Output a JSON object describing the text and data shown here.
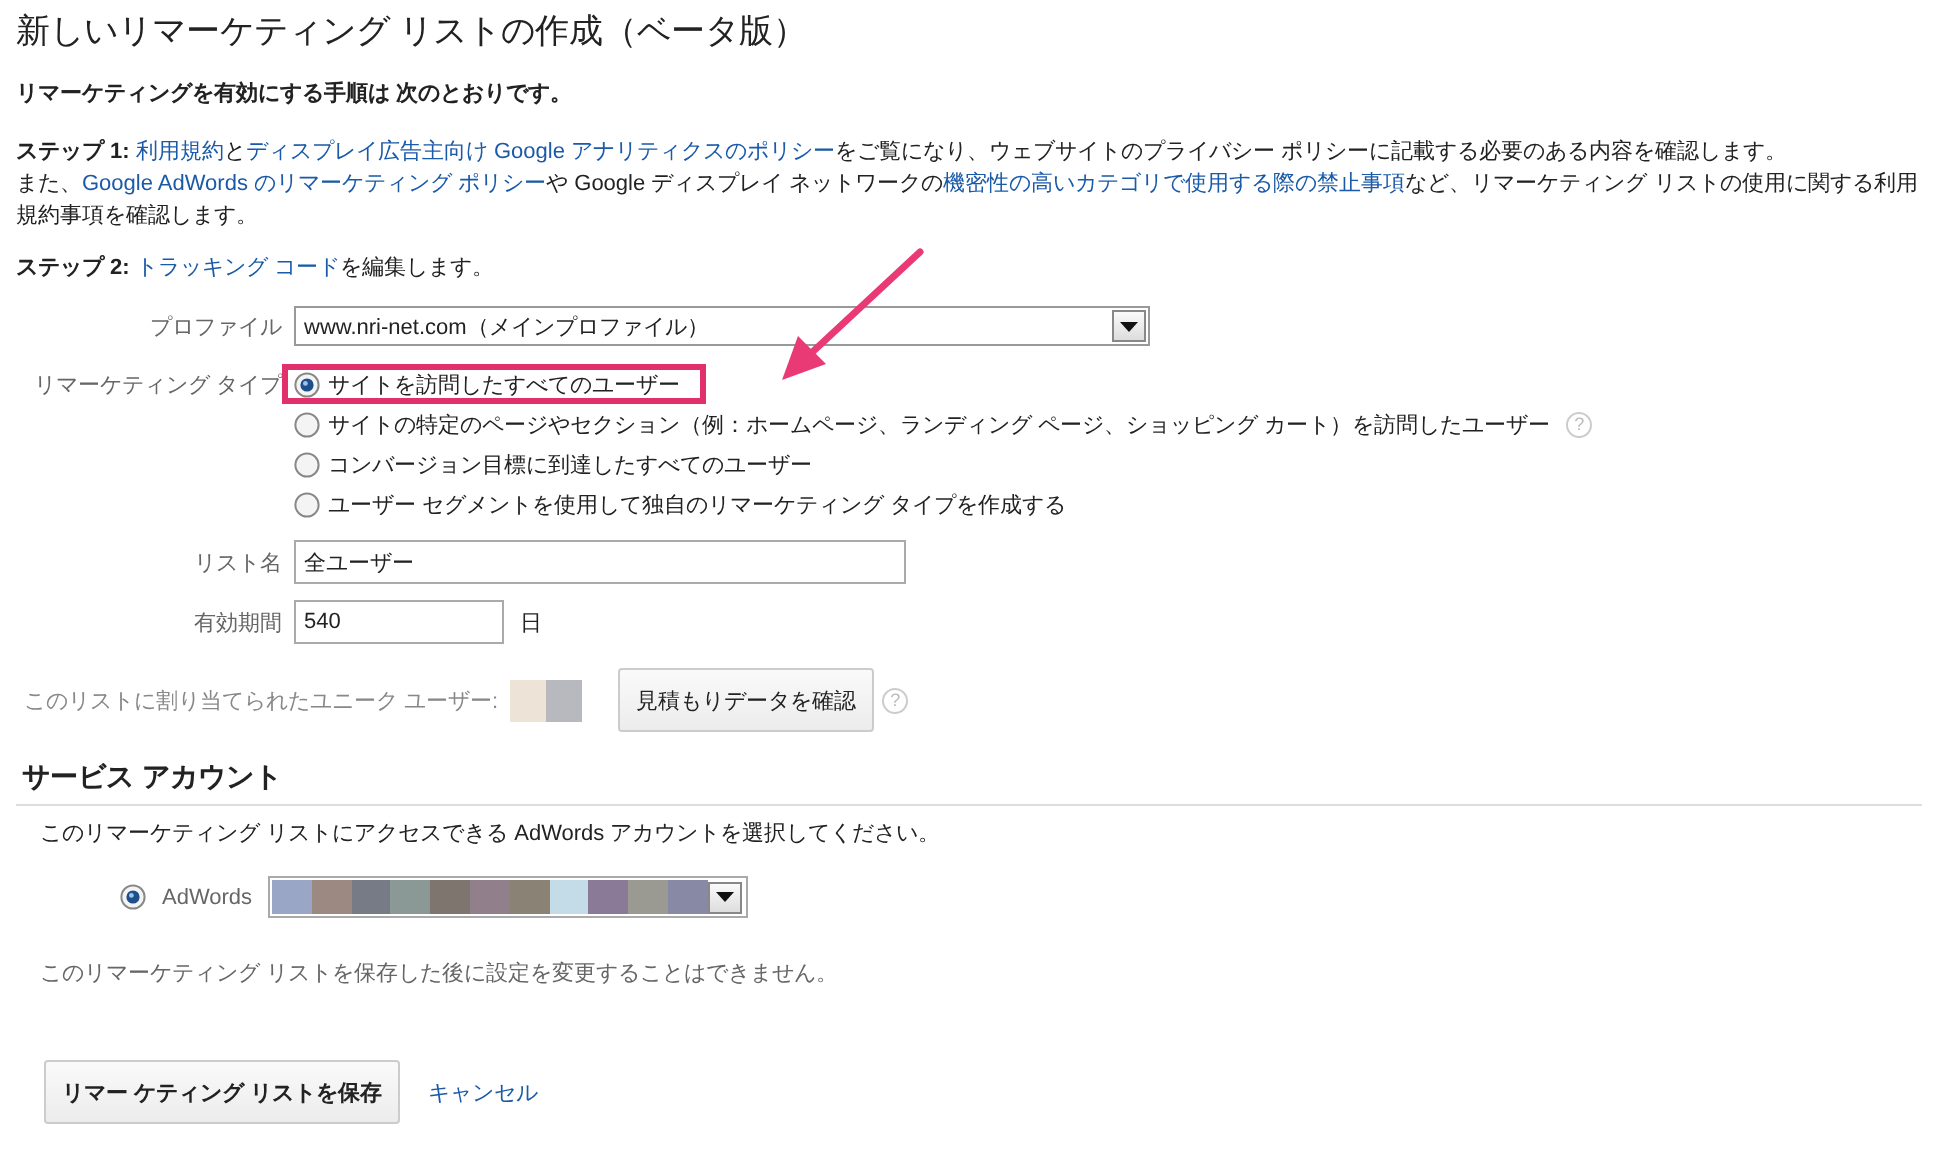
{
  "title": "新しいリマーケティング リストの作成（ベータ版）",
  "intro": "リマーケティングを有効にする手順は 次のとおりです。",
  "steps": [
    {
      "parts": [
        {
          "kind": "bold",
          "text": "ステップ 1:"
        },
        {
          "kind": "link",
          "text": "利用規約"
        },
        {
          "kind": "text",
          "text": "と"
        },
        {
          "kind": "link",
          "text": "ディスプレイ広告主向け Google アナリティクスのポリシー"
        },
        {
          "kind": "text",
          "text": "をご覧になり、ウェブサイトのプライバシー ポリシーに記載する必要のある内容を確認します。"
        },
        {
          "kind": "break",
          "text": "また、"
        },
        {
          "kind": "link",
          "text": "Google AdWords のリマーケティング ポリシー"
        },
        {
          "kind": "text",
          "text": "や Google ディスプレイ ネットワークの"
        },
        {
          "kind": "link",
          "text": "機密性の高いカテゴリで使用する際の禁止事項"
        },
        {
          "kind": "text",
          "text": "など、リマーケティング リストの使用に関する利用規約事項を確認します。"
        }
      ]
    },
    {
      "parts": [
        {
          "kind": "bold",
          "text": "ステップ 2:"
        },
        {
          "kind": "link",
          "text": "トラッキング コード"
        },
        {
          "kind": "text",
          "text": "を編集します。"
        }
      ]
    }
  ],
  "profile": {
    "label": "プロファイル",
    "value": "www.nri-net.com（メインプロファイル）"
  },
  "remarketing_type": {
    "label": "リマーケティング タイプ",
    "options": [
      {
        "label": "サイトを訪問したすべてのユーザー",
        "selected": true,
        "highlighted": true
      },
      {
        "label": "サイトの特定のページやセクション（例：ホームページ、ランディング ページ、ショッピング カート）を訪問したユーザー",
        "selected": false,
        "highlighted": false,
        "help": "?"
      },
      {
        "label": "コンバージョン目標に到達したすべてのユーザー",
        "selected": false,
        "highlighted": false
      },
      {
        "label": "ユーザー セグメントを使用して独自のリマーケティング タイプを作成する",
        "selected": false,
        "highlighted": false
      }
    ]
  },
  "list_name": {
    "label": "リスト名",
    "value": "全ユーザー"
  },
  "duration": {
    "label": "有効期間",
    "value": "540",
    "unit": "日"
  },
  "unique_users": {
    "label": "このリストに割り当てられたユニーク ユーザー:",
    "button": "見積もりデータを確認",
    "help": "?"
  },
  "service_account": {
    "heading": "サービス アカウント",
    "description": "このリマーケティング リストにアクセスできる AdWords アカウントを選択してください。",
    "account": {
      "label": "AdWords",
      "selected": true
    },
    "note": "このリマーケティング リストを保存した後に設定を変更することはできません。"
  },
  "actions": {
    "save": "リマー ケティング リストを保存",
    "cancel": "キャンセル"
  }
}
